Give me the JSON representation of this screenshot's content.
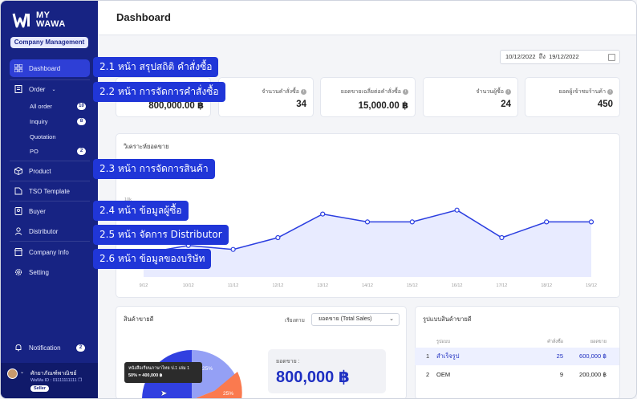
{
  "brand": {
    "line1": "MY",
    "line2": "WAWA",
    "badge": "Company Management"
  },
  "header": {
    "title": "Dashboard"
  },
  "date_range": {
    "from": "10/12/2022",
    "sep": "ถึง",
    "to": "19/12/2022"
  },
  "nav": {
    "dashboard": "Dashboard",
    "order": "Order",
    "all_order": "All order",
    "all_order_count": "10",
    "inquiry": "Inquiry",
    "inquiry_count": "8",
    "quotation": "Quotation",
    "po": "PO",
    "po_count": "2",
    "product": "Product",
    "tso": "TSO Template",
    "buyer": "Buyer",
    "distributor": "Distributor",
    "company": "Company Info",
    "setting": "Setting",
    "notification": "Notification",
    "notification_count": "2"
  },
  "user": {
    "name": "ศักยาภัณฑ์พาณิชย์",
    "id": "WaWa ID : 01111111111",
    "role": "Seller"
  },
  "kpis": [
    {
      "label": "",
      "value": "800,000.00 ฿"
    },
    {
      "label": "จำนวนคำสั่งซื้อ",
      "value": "34"
    },
    {
      "label": "ยอดขายเฉลี่ยต่อคำสั่งซื้อ",
      "value": "15,000.00 ฿"
    },
    {
      "label": "จำนวนผู้ซื้อ",
      "value": "24"
    },
    {
      "label": "ยอดผู้เข้าชมร้านค้า",
      "value": "450"
    }
  ],
  "callouts": [
    "2.1 หน้า สรุปสถิติ คำสั่งซื้อ",
    "2.2 หน้า การจัดการคำสั่งซื้อ",
    "2.3 หน้า การจัดการสินค้า",
    "2.4 หน้า ข้อมูลผู้ซื้อ",
    "2.5 หน้า จัดการ Distributor",
    "2.6 หน้า ข้อมูลของบริษัท"
  ],
  "sales_analysis": {
    "title": "วิเคราะห์ยอดขาย"
  },
  "best_products": {
    "title": "สินค้าขายดี",
    "sort_label": "เรียงตาม",
    "sort_value": "ยอดขาย (Total Sales)",
    "total_label": "ยอดขาย :",
    "total_value": "800,000 ฿",
    "tooltip_line1": "หนังสือเรียนภาษาไทย ป.1 เล่ม 1",
    "tooltip_line2": "50% = 400,000 ฿",
    "pie_labels": [
      "25%",
      "25%"
    ]
  },
  "pattern_table": {
    "title": "รูปแบบสินค้าขายดี",
    "headers": [
      "รูปแบบ",
      "คำสั่งซื้อ",
      "ยอดขาย"
    ],
    "rows": [
      {
        "rank": "1",
        "name": "สำเร็จรูป",
        "orders": "25",
        "sales": "600,000 ฿"
      },
      {
        "rank": "2",
        "name": "OEM",
        "orders": "9",
        "sales": "200,000 ฿"
      }
    ]
  },
  "chart_data": {
    "type": "area",
    "x": [
      "9/12",
      "10/12",
      "11/12",
      "12/12",
      "13/12",
      "14/12",
      "15/12",
      "16/12",
      "17/12",
      "18/12",
      "19/12"
    ],
    "y_ticks": [
      "10k"
    ],
    "values": [
      3,
      4,
      3.5,
      5,
      8,
      7,
      7,
      8.5,
      5,
      7,
      7
    ],
    "ylim": [
      0,
      10
    ]
  }
}
